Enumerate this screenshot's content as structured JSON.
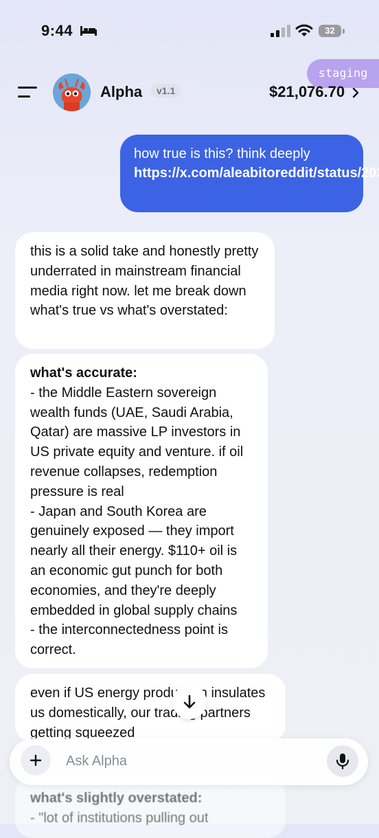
{
  "status_bar": {
    "time": "9:44",
    "battery": "32"
  },
  "header": {
    "staging_label": "staging",
    "app_name": "Alpha",
    "version": "v1.1",
    "balance": "$21,076.70"
  },
  "chat": {
    "user_message": {
      "text": "how true is this? think deeply",
      "link": "https://x.com/aleabitoreddit/status/203..."
    },
    "assistant_messages": [
      {
        "text": "this is a solid take and honestly pretty underrated in mainstream financial media right now. let me break down what's true vs what's overstated:"
      },
      {
        "heading": "what's accurate:",
        "body": "- the Middle Eastern sovereign wealth funds (UAE, Saudi Arabia, Qatar) are massive LP investors in US private equity and venture. if oil revenue collapses, redemption pressure is real\n- Japan and South Korea are genuinely exposed — they import nearly all their energy. $110+ oil is an economic gut punch for both economies, and they're deeply embedded in global supply chains\n- the interconnectedness point is correct."
      },
      {
        "text": "even if US energy production insulates us domestically, our trading partners getting squeezed"
      },
      {
        "heading": "what's slightly overstated:",
        "text": "- \"lot of institutions pulling out"
      }
    ]
  },
  "composer": {
    "placeholder": "Ask Alpha"
  }
}
